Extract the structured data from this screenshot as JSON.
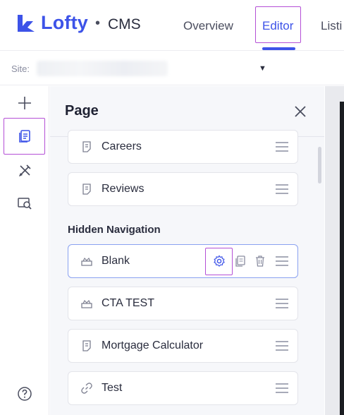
{
  "brand": {
    "name": "Lofty",
    "separator": "•",
    "product": "CMS"
  },
  "nav": {
    "tabs": [
      {
        "label": "Overview"
      },
      {
        "label": "Editor"
      },
      {
        "label": "Listi"
      }
    ],
    "active_tab": "Editor"
  },
  "site": {
    "label": "Site:",
    "value_hidden": true
  },
  "rail": {
    "items": [
      {
        "icon": "plus-icon",
        "active": false
      },
      {
        "icon": "pages-icon",
        "active": true
      },
      {
        "icon": "design-tools-icon",
        "active": false
      },
      {
        "icon": "preview-search-icon",
        "active": false
      }
    ],
    "help_icon": "help-icon"
  },
  "panel": {
    "title": "Page",
    "pages": [
      {
        "label": "Careers",
        "icon": "page-icon"
      },
      {
        "label": "Reviews",
        "icon": "page-icon"
      }
    ],
    "hidden_section_label": "Hidden Navigation",
    "hidden_pages": [
      {
        "label": "Blank",
        "icon": "template-icon",
        "selected": true,
        "actions": [
          "settings-gear-icon",
          "duplicate-icon",
          "trash-icon"
        ]
      },
      {
        "label": "CTA TEST",
        "icon": "template-icon"
      },
      {
        "label": "Mortgage Calculator",
        "icon": "page-icon"
      },
      {
        "label": "Test",
        "icon": "link-icon"
      }
    ]
  },
  "colors": {
    "accent": "#3d53e8",
    "highlight": "#b44fd6",
    "panel_bg": "#f6f7fa"
  }
}
